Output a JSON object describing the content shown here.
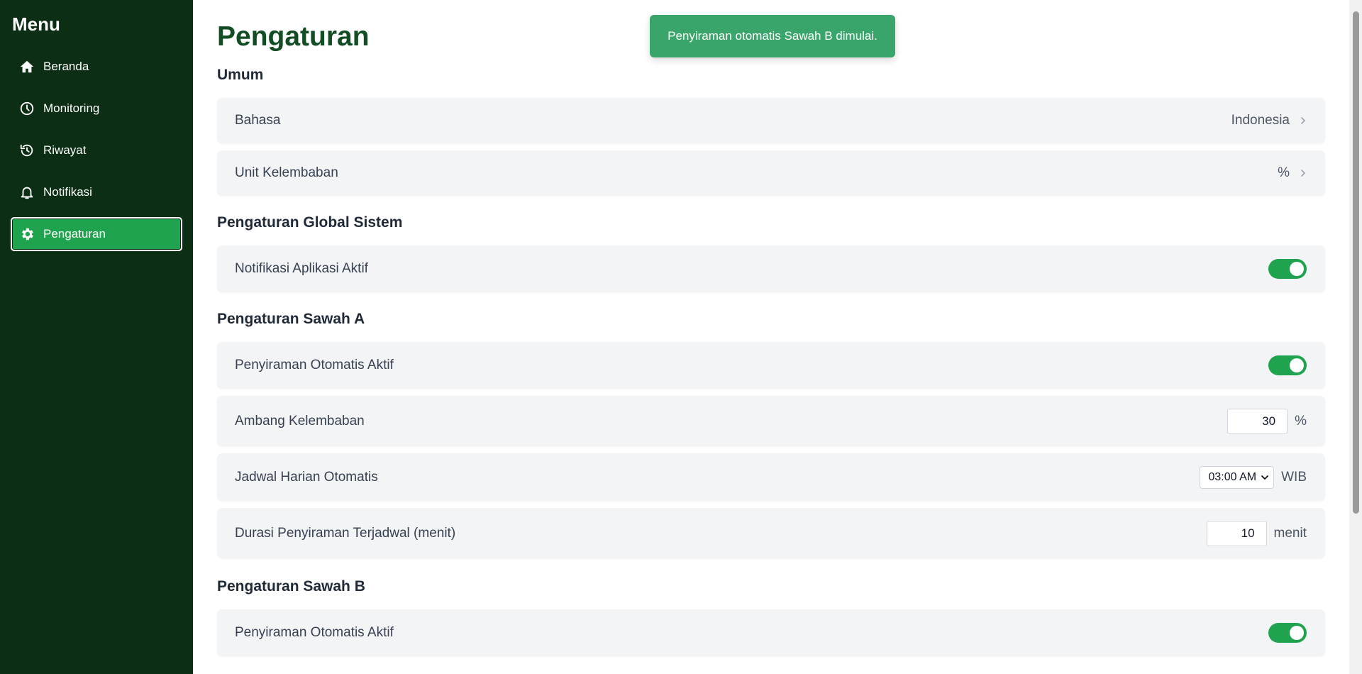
{
  "sidebar": {
    "title": "Menu",
    "items": [
      {
        "label": "Beranda",
        "icon": "home-icon"
      },
      {
        "label": "Monitoring",
        "icon": "clock-icon"
      },
      {
        "label": "Riwayat",
        "icon": "history-icon"
      },
      {
        "label": "Notifikasi",
        "icon": "bell-icon"
      },
      {
        "label": "Pengaturan",
        "icon": "gear-icon",
        "active": true
      }
    ]
  },
  "page": {
    "title": "Pengaturan"
  },
  "toast": {
    "message": "Penyiraman otomatis Sawah B dimulai."
  },
  "sections": {
    "umum": {
      "title": "Umum",
      "bahasa": {
        "label": "Bahasa",
        "value": "Indonesia"
      },
      "unit": {
        "label": "Unit Kelembaban",
        "value": "%"
      }
    },
    "global": {
      "title": "Pengaturan Global Sistem",
      "notif": {
        "label": "Notifikasi Aplikasi Aktif",
        "on": true
      }
    },
    "sawahA": {
      "title": "Pengaturan Sawah A",
      "auto": {
        "label": "Penyiraman Otomatis Aktif",
        "on": true
      },
      "threshold": {
        "label": "Ambang Kelembaban",
        "value": "30",
        "unit": "%"
      },
      "schedule": {
        "label": "Jadwal Harian Otomatis",
        "value": "03:00 AM",
        "unit": "WIB"
      },
      "duration": {
        "label": "Durasi Penyiraman Terjadwal (menit)",
        "value": "10",
        "unit": "menit"
      }
    },
    "sawahB": {
      "title": "Pengaturan Sawah B",
      "auto": {
        "label": "Penyiraman Otomatis Aktif",
        "on": true
      }
    }
  },
  "colors": {
    "sidebar_bg": "#0b2e14",
    "accent": "#20a34e",
    "title": "#124d23",
    "toast_bg": "#3aa56a"
  }
}
